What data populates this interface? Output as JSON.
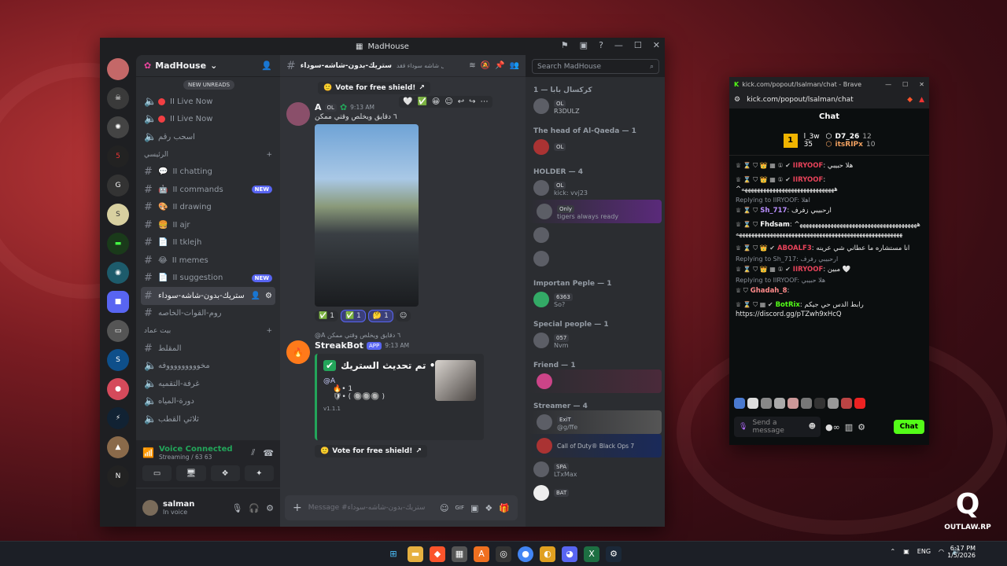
{
  "discord": {
    "window_title": "MadHouse",
    "server_name": "MadHouse",
    "new_unreads": "NEW UNREADS",
    "channels_top": [
      {
        "icon": "speaker",
        "label": "II Live Now",
        "live": true
      },
      {
        "icon": "speaker",
        "label": "II Live Now",
        "live": true
      },
      {
        "icon": "speaker",
        "label": "اسحب رقم",
        "live": false
      }
    ],
    "category_main": "الرئيسي",
    "channels_main": [
      {
        "emoji": "💬",
        "label": "II chatting",
        "new": false
      },
      {
        "emoji": "🤖",
        "label": "II commands",
        "new": true
      },
      {
        "emoji": "🎨",
        "label": "II drawing",
        "new": false
      },
      {
        "emoji": "🍔",
        "label": "II ajr",
        "new": false
      },
      {
        "emoji": "📄",
        "label": "II tklejh",
        "new": false
      },
      {
        "emoji": "😂",
        "label": "II memes",
        "new": false
      },
      {
        "emoji": "📄",
        "label": "II suggestion",
        "new": true
      }
    ],
    "active_channel": "ستريك-بدون-شاشه-سوداء",
    "channel_roomf": "روم-القوات-الخاصه",
    "category_house": "بيت عماد",
    "channels_house": [
      "المقلط",
      "مخوووووووووفه",
      "غرفة-التقميه",
      "دورة-المياه",
      "ثلاثي القطب"
    ],
    "new_badge": "NEW",
    "voice_status": "Voice Connected",
    "voice_sub": "Streaming / 63 63",
    "user_name": "salman",
    "user_status": "In voice",
    "header_channel": "ستريك-بدون-شاشه-سوداء",
    "header_topic": "بل شاشه سوداء ققد",
    "search_placeholder": "Search MadHouse",
    "vote_label": "Vote for free shield!",
    "msg_author": "A",
    "msg_time": "9:13 AM",
    "msg_text": "٦ دقايق ويخلص وقتي ممكن",
    "role_tag": "OL",
    "reactions": [
      {
        "e": "✅",
        "n": "1"
      },
      {
        "e": "✅",
        "n": "1"
      },
      {
        "e": "🤔",
        "n": "1"
      }
    ],
    "reply_ref": "@A ٦ دقايق ويخلص وقتي ممكن",
    "bot_name": "StreakBot",
    "bot_tag": "APP",
    "bot_time": "9:13 AM",
    "embed_title": "تم تحديث الستريك •",
    "embed_user": "@A",
    "embed_line1": "• 1",
    "embed_line2": "• ( 🔘🔘🔘 )",
    "embed_footer": "v1.1.1",
    "vote_label2": "Vote for free shield!",
    "composer_placeholder": "Message #ستريك-بدون-شاشه-سوداء",
    "member_groups": [
      {
        "title": "كركسال بابا — 1",
        "members": [
          {
            "name": "R3DULZ",
            "tag": "OL"
          }
        ]
      },
      {
        "title": "The head of Al-Qaeda — 1",
        "members": [
          {
            "name": "",
            "tag": "OL"
          }
        ]
      },
      {
        "title": "HOLDER — 4",
        "members": [
          {
            "name": "kick: vvj23",
            "tag": "OL"
          },
          {
            "name": "tigers always ready",
            "tag": "Only"
          },
          {
            "name": "",
            "tag": ""
          },
          {
            "name": "",
            "tag": ""
          }
        ]
      },
      {
        "title": "Importan Peple — 1",
        "members": [
          {
            "name": "So?",
            "tag": "6363"
          }
        ]
      },
      {
        "title": "Special people — 1",
        "members": [
          {
            "name": "Nvm",
            "tag": "057"
          }
        ]
      },
      {
        "title": "Friend — 1",
        "members": [
          {
            "name": "",
            "tag": ""
          }
        ]
      },
      {
        "title": "Streamer — 4",
        "members": [
          {
            "name": "@g/ffe",
            "tag": "ExiT"
          },
          {
            "name": "Call of Duty® Black Ops 7",
            "tag": ""
          },
          {
            "name": "LTxMax",
            "tag": "SPA"
          },
          {
            "name": "",
            "tag": "BAT"
          }
        ]
      }
    ]
  },
  "kick": {
    "url_title": "kick.com/popout/lsalman/chat - Brave",
    "address": "kick.com/popout/lsalman/chat",
    "chat_title": "Chat",
    "top_users": [
      {
        "name": "l_3w",
        "count": "35"
      },
      {
        "name": "D7_26",
        "count": "12"
      },
      {
        "name": "itsRIPx",
        "count": "10"
      }
    ],
    "messages": [
      {
        "reply": "",
        "user": "IIRYOOF",
        "text": "هلا حبيبي"
      },
      {
        "reply": "",
        "user": "IIRYOOF",
        "text": "^ههههههههههههههههههههههههههههههه"
      },
      {
        "reply": "Replying to IIRYOOF: اهلا",
        "user": "Sh_717",
        "text": "ارحبيبي زفرف"
      },
      {
        "reply": "",
        "user": "Fhdsam",
        "text": "^ههههههههههههههههههههههههههههههههههههههههههههههههههههههههههههههههههههههههههههههههههههههههههههه"
      },
      {
        "reply": "",
        "user": "ABOALF3",
        "text": "انا مستشاره ما عطاني شي عرينه"
      },
      {
        "reply": "Replying to Sh_717: ارحبيبي رفرف",
        "user": "IIRYOOF",
        "text": "مبين 🤍"
      },
      {
        "reply": "Replying to IIRYOOF: هلا حبيبي",
        "user": "Ghadah_8",
        "text": ""
      },
      {
        "reply": "",
        "user": "BotRix",
        "text": "رابط الدس حي جيكم https://discord.gg/pTZwh9xHcQ"
      }
    ],
    "send_placeholder": "Send a message",
    "chat_button": "Chat"
  },
  "taskbar": {
    "lang": "ENG",
    "time": "6:17 PM",
    "date": "1/5/2026"
  },
  "watermark": "OUTLAW.RP"
}
